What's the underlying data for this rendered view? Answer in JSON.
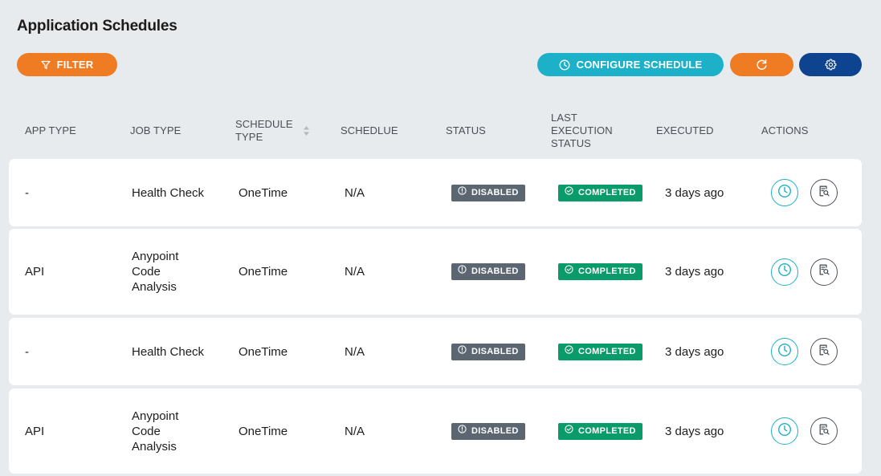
{
  "page": {
    "title": "Application Schedules"
  },
  "toolbar": {
    "filter_label": "FILTER",
    "configure_label": "CONFIGURE SCHEDULE"
  },
  "colors": {
    "filter": "#ef7b23",
    "configure": "#1db0c9",
    "refresh": "#ef7b23",
    "settings": "#0d438f",
    "disabled_badge": "#5b6670",
    "completed_badge": "#0a9b6a"
  },
  "table": {
    "headers": {
      "app_type": "APP TYPE",
      "job_type": "JOB TYPE",
      "schedule_type_1": "SCHEDULE",
      "schedule_type_2": "TYPE",
      "schedule": "SCHEDLUE",
      "status": "STATUS",
      "last_exec_1": "LAST",
      "last_exec_2": "EXECUTION",
      "last_exec_3": "STATUS",
      "executed": "EXECUTED",
      "actions": "ACTIONS"
    },
    "rows": [
      {
        "app_type": "-",
        "job_type": "Health Check",
        "schedule_type": "OneTime",
        "schedule": "N/A",
        "status": "DISABLED",
        "last_execution_status": "COMPLETED",
        "executed": "3 days ago"
      },
      {
        "app_type": "API",
        "job_type": "Anypoint Code Analysis",
        "schedule_type": "OneTime",
        "schedule": "N/A",
        "status": "DISABLED",
        "last_execution_status": "COMPLETED",
        "executed": "3 days ago"
      },
      {
        "app_type": "-",
        "job_type": "Health Check",
        "schedule_type": "OneTime",
        "schedule": "N/A",
        "status": "DISABLED",
        "last_execution_status": "COMPLETED",
        "executed": "3 days ago"
      },
      {
        "app_type": "API",
        "job_type": "Anypoint Code Analysis",
        "schedule_type": "OneTime",
        "schedule": "N/A",
        "status": "DISABLED",
        "last_execution_status": "COMPLETED",
        "executed": "3 days ago"
      }
    ]
  },
  "icons": {
    "filter": "filter-icon",
    "configure": "clock-icon",
    "refresh": "refresh-icon",
    "settings": "gear-icon",
    "status": "info-circle-icon",
    "completed": "check-circle-icon",
    "row_schedule": "clock-icon",
    "row_report": "report-search-icon"
  }
}
